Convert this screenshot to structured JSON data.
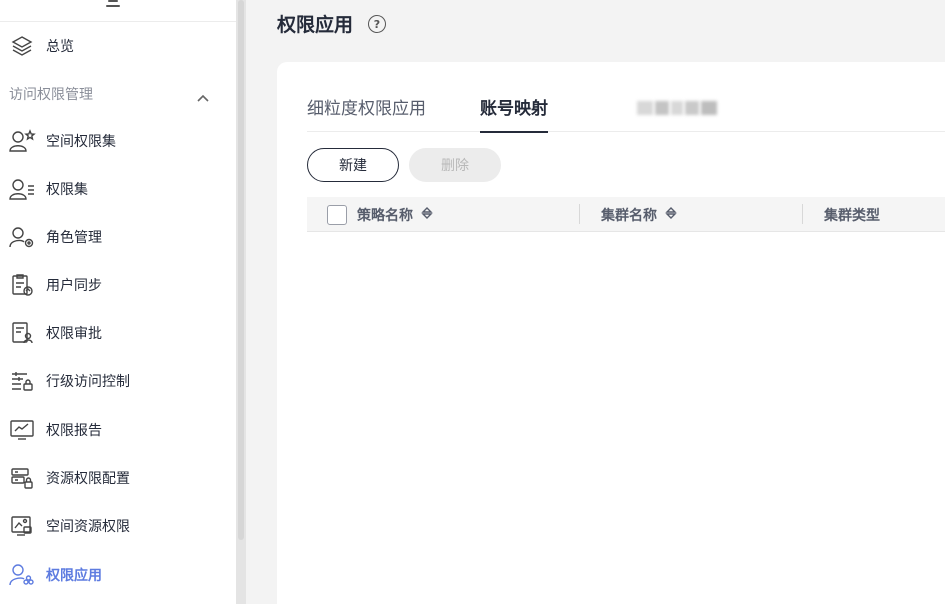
{
  "sidebar": {
    "items": [
      {
        "label": "总览",
        "icon": "layers-icon"
      },
      {
        "label": "空间权限集",
        "icon": "user-star-icon"
      },
      {
        "label": "权限集",
        "icon": "user-list-icon"
      },
      {
        "label": "角色管理",
        "icon": "user-gear-icon"
      },
      {
        "label": "用户同步",
        "icon": "clipboard-sync-icon"
      },
      {
        "label": "权限审批",
        "icon": "document-user-icon"
      },
      {
        "label": "行级访问控制",
        "icon": "row-lock-icon"
      },
      {
        "label": "权限报告",
        "icon": "monitor-chart-icon"
      },
      {
        "label": "资源权限配置",
        "icon": "server-lock-icon"
      },
      {
        "label": "空间资源权限",
        "icon": "image-lock-icon"
      },
      {
        "label": "权限应用",
        "icon": "user-apps-icon"
      }
    ],
    "group_label": "访问权限管理",
    "active_color": "#5e7ce0"
  },
  "header": {
    "title": "权限应用",
    "help": "?"
  },
  "tabs": [
    {
      "label": "细粒度权限应用"
    },
    {
      "label": "账号映射"
    }
  ],
  "toolbar": {
    "new_label": "新建",
    "delete_label": "删除"
  },
  "table": {
    "columns": [
      "策略名称",
      "集群名称",
      "集群类型"
    ]
  }
}
